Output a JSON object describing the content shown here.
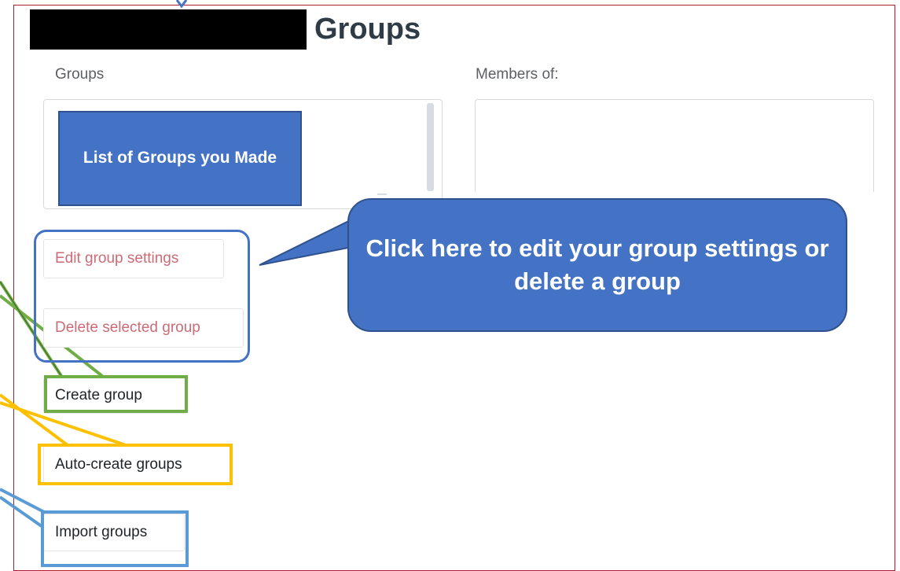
{
  "page": {
    "title": "Groups"
  },
  "groups_panel": {
    "label": "Groups",
    "callout": "List of Groups you Made"
  },
  "members_panel": {
    "label": "Members of:"
  },
  "buttons": {
    "edit": "Edit group settings",
    "delete": "Delete selected group",
    "create": "Create group",
    "auto_create": "Auto-create groups",
    "import": "Import groups"
  },
  "speech_callout": {
    "text": "Click here to edit your group settings or delete a group"
  },
  "colors": {
    "callout_fill": "#4472c4",
    "delete_edit_text": "#cd6b76",
    "highlight_green": "#70ad47",
    "highlight_yellow": "#ffc000",
    "highlight_light_blue": "#5b9bd5",
    "frame_border": "#b01c2e"
  }
}
